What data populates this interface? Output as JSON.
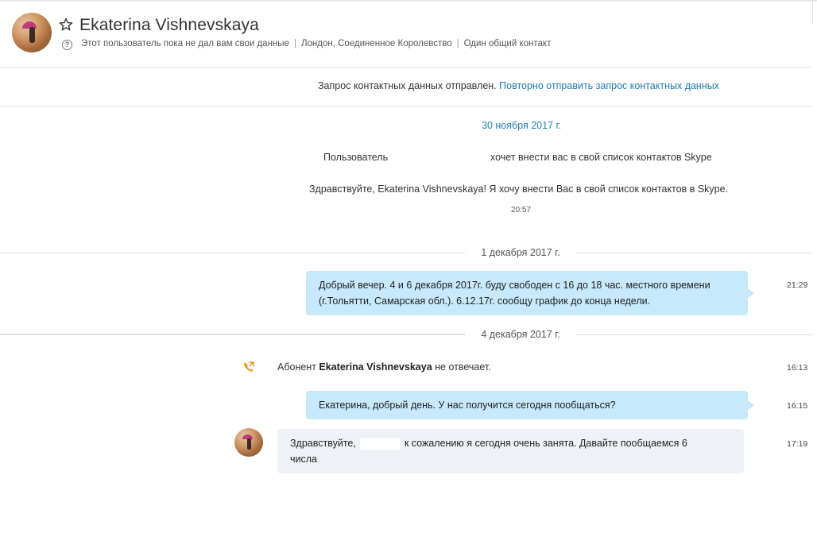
{
  "header": {
    "contact_name": "Ekaterina Vishnevskaya",
    "meta": [
      "Этот пользователь пока не дал вам свои данные",
      "Лондон, Соединенное Королевство",
      "Один общий контакт"
    ]
  },
  "notice": {
    "text": "Запрос контактных данных отправлен.",
    "link": "Повторно отправить запрос контактных данных"
  },
  "conversation": {
    "date1": "30 ноября 2017 г.",
    "request_part1": "Пользователь",
    "request_part2": "хочет внести вас в свой список контактов Skype",
    "greeting": "Здравствуйте, Ekaterina Vishnevskaya! Я хочу внести Вас в свой список контактов в Skype.",
    "greeting_time": "20:57",
    "date2": "1 декабря 2017 г.",
    "msg1_line1": "Добрый вечер. 4 и 6 декабря 2017г. буду свободен с 16 до 18 час. местного времени",
    "msg1_line2": "(г.Тольятти, Самарская обл.). 6.12.17г. сообщу график до конца недели.",
    "msg1_time": "21:29",
    "date3": "4 декабря 2017 г.",
    "call_prefix": "Абонент",
    "call_name": "Ekaterina Vishnevskaya",
    "call_suffix": "не отвечает.",
    "call_time": "16:13",
    "msg2": "Екатерина, добрый день. У нас получится сегодня пообщаться?",
    "msg2_time": "16:15",
    "msg3_part1": "Здравствуйте,",
    "msg3_part2": "к сожалению я сегодня очень занята. Давайте пообщаемся 6",
    "msg3_line2": "числа",
    "msg3_time": "17:19"
  },
  "colors": {
    "accent_link": "#1f7bb0",
    "outgoing_bubble": "#c7e9fb",
    "incoming_bubble": "#eef1f5",
    "call_icon": "#e8941a"
  }
}
